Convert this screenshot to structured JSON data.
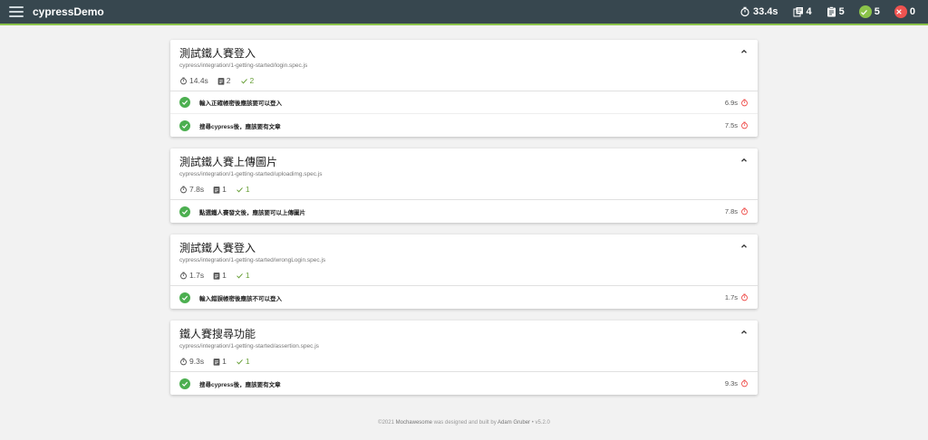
{
  "navbar": {
    "brand": "cypressDemo",
    "duration": "33.4s",
    "suites": "4",
    "tests": "5",
    "passed": "5",
    "failed": "0"
  },
  "suites": [
    {
      "title": "測試鐵人賽登入",
      "file": "cypress/integration/1-getting-started/login.spec.js",
      "duration": "14.4s",
      "tests": "2",
      "passed": "2",
      "rows": [
        {
          "title": "輸入正確帳密後應該要可以登入",
          "duration": "6.9s"
        },
        {
          "title": "搜尋cypress後，應該要有文章",
          "duration": "7.5s"
        }
      ]
    },
    {
      "title": "測試鐵人賽上傳圖片",
      "file": "cypress/integration/1-getting-started/uploadimg.spec.js",
      "duration": "7.8s",
      "tests": "1",
      "passed": "1",
      "rows": [
        {
          "title": "點選鐵人賽發文後，應該要可以上傳圖片",
          "duration": "7.8s"
        }
      ]
    },
    {
      "title": "測試鐵人賽登入",
      "file": "cypress/integration/1-getting-started/wrongLogin.spec.js",
      "duration": "1.7s",
      "tests": "1",
      "passed": "1",
      "rows": [
        {
          "title": "輸入錯誤帳密後應該不可以登入",
          "duration": "1.7s"
        }
      ]
    },
    {
      "title": "鐵人賽搜尋功能",
      "file": "cypress/integration/1-getting-started/assertion.spec.js",
      "duration": "9.3s",
      "tests": "1",
      "passed": "1",
      "rows": [
        {
          "title": "搜尋cypress後，應該要有文章",
          "duration": "9.3s"
        }
      ]
    }
  ],
  "footer": {
    "prefix": "©2021",
    "brand": "Mochawesome",
    "middle": "was designed and built by",
    "author": "Adam Gruber",
    "version": "• v5.2.0"
  },
  "colors": {
    "navbar": "#37474f",
    "accent": "#8bc34a",
    "pass": "#4caf50",
    "fail": "#ef5350"
  }
}
